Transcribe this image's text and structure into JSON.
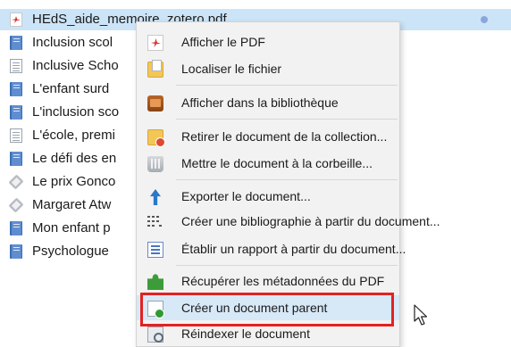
{
  "items": [
    {
      "title": "HEdS_aide_memoire_zotero.pdf",
      "icon": "pdf-icon",
      "selected": true
    },
    {
      "title": "Inclusion scol",
      "icon": "book-icon"
    },
    {
      "title": "Inclusive Scho",
      "icon": "document-icon"
    },
    {
      "title": "L'enfant surd",
      "icon": "book-icon"
    },
    {
      "title": "L'inclusion sco",
      "icon": "book-icon"
    },
    {
      "title": "L'école, premi",
      "icon": "document-icon"
    },
    {
      "title": "Le défi des en",
      "icon": "book-icon"
    },
    {
      "title": "Le prix Gonco",
      "icon": "webpage-icon"
    },
    {
      "title": "Margaret Atw",
      "icon": "webpage-icon"
    },
    {
      "title": "Mon enfant p",
      "icon": "book-icon"
    },
    {
      "title": "Psychologue",
      "icon": "book-icon"
    }
  ],
  "context_menu": {
    "items": [
      {
        "label": "Afficher le PDF",
        "icon": "pdf-icon"
      },
      {
        "label": "Localiser le fichier",
        "icon": "folder-icon"
      },
      {
        "label": "Afficher dans la bibliothèque",
        "icon": "library-icon"
      },
      {
        "label": "Retirer le document de la collection...",
        "icon": "remove-from-collection-icon"
      },
      {
        "label": "Mettre le document à la corbeille...",
        "icon": "trash-icon"
      },
      {
        "label": "Exporter le document...",
        "icon": "export-icon"
      },
      {
        "label": "Créer une bibliographie à partir du document...",
        "icon": "bibliography-icon"
      },
      {
        "label": "Établir un rapport à partir du document...",
        "icon": "report-icon"
      },
      {
        "label": "Récupérer les métadonnées du PDF",
        "icon": "puzzle-icon"
      },
      {
        "label": "Créer un document parent",
        "icon": "create-parent-icon",
        "hovered": true
      },
      {
        "label": "Réindexer le document",
        "icon": "reindex-icon"
      }
    ]
  },
  "colors": {
    "selection": "#cce4f7",
    "menu_background": "#f2f2f2",
    "hover": "#d7e8f7",
    "highlight_border": "#e22222"
  }
}
